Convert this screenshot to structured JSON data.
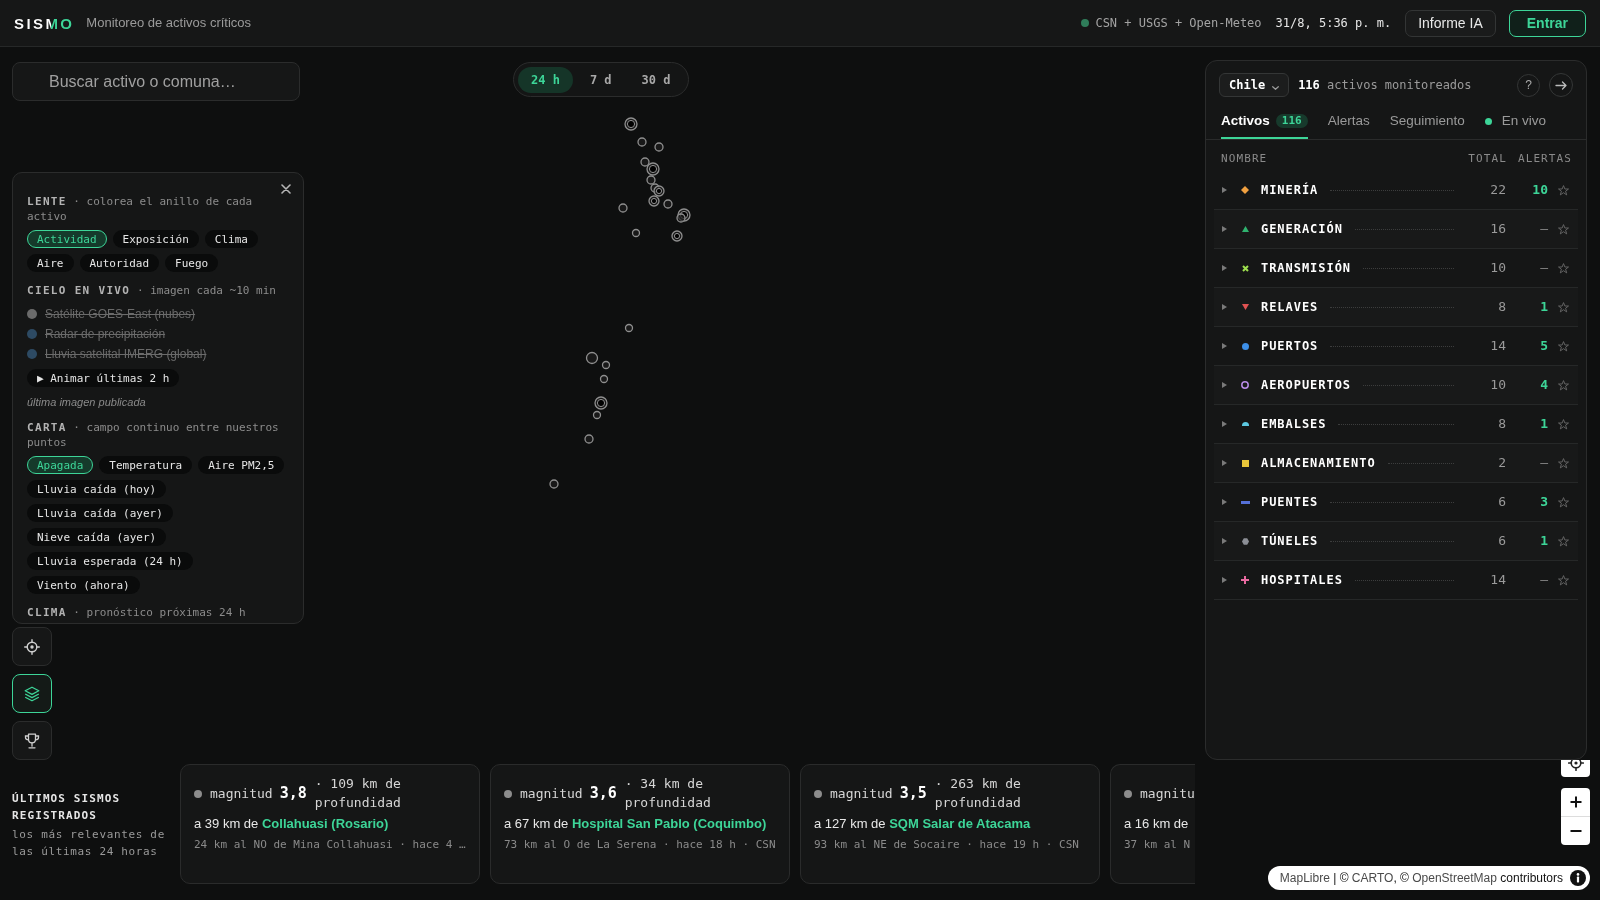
{
  "header": {
    "logo": "SISMO",
    "subtitle": "Monitoreo de activos críticos",
    "sources": "CSN + USGS + Open-Meteo",
    "datetime": "31/8, 5:36 p. m.",
    "buttons": [
      {
        "label": "Informe IA",
        "kind": "secondary"
      },
      {
        "label": "Entrar",
        "kind": "primary"
      }
    ]
  },
  "search": {
    "placeholder": "Buscar activo o comuna…"
  },
  "time_range": [
    {
      "label": "24 h",
      "selected": true
    },
    {
      "label": "7 d",
      "selected": false
    },
    {
      "label": "30 d",
      "selected": false
    }
  ],
  "layers_panel": {
    "sections": [
      {
        "kind": "chips",
        "heading": "**LENTE** · colorea el anillo de cada activo",
        "chips": [
          {
            "label": "Actividad",
            "selected": true
          },
          {
            "label": "Exposición",
            "selected": false
          },
          {
            "label": "Clima",
            "selected": false
          },
          {
            "label": "Aire",
            "selected": false
          },
          {
            "label": "Autoridad",
            "selected": false
          },
          {
            "label": "Fuego",
            "selected": false
          }
        ]
      },
      {
        "kind": "live",
        "heading": "**CIELO EN VIVO** · imagen cada ~10 min",
        "layers": [
          {
            "label": "Satélite GOES-East (nubes)",
            "on": false,
            "color": "#6b6b6b"
          },
          {
            "label": "Radar de precipitación",
            "on": false,
            "color": "#2d4a63"
          },
          {
            "label": "Lluvia satelital IMERG (global)",
            "on": false,
            "color": "#2d4a63"
          }
        ],
        "action": "▶ Animar últimas 2 h",
        "note": "última imagen publicada"
      },
      {
        "kind": "chips",
        "heading": "**CARTA** · campo continuo entre nuestros puntos",
        "chips": [
          {
            "label": "Apagada",
            "selected": true
          },
          {
            "label": "Temperatura",
            "selected": false
          },
          {
            "label": "Aire PM2,5",
            "selected": false
          },
          {
            "label": "Lluvia caída (hoy)",
            "selected": false
          },
          {
            "label": "Lluvia caída (ayer)",
            "selected": false
          },
          {
            "label": "Nieve caída (ayer)",
            "selected": false
          },
          {
            "label": "Lluvia esperada (24 h)",
            "selected": false
          },
          {
            "label": "Viento (ahora)",
            "selected": false
          }
        ]
      },
      {
        "kind": "heading",
        "heading": "**CLIMA** · pronóstico próximas 24 h"
      }
    ]
  },
  "tool_buttons": [
    {
      "selected": false
    },
    {
      "selected": true
    },
    {
      "selected": false
    }
  ],
  "recent_quakes": {
    "title": "ÚLTIMOS SISMOS REGISTRADOS",
    "subtitle": "los más relevantes de las últimas 24 horas",
    "cards": [
      {
        "label": "magnitud",
        "magnitude": "3,8",
        "depth": "· 109 km de profundidad",
        "distance": "a 39 km de",
        "asset": "Collahuasi (Rosario)",
        "detail": "24 km al NO de Mina Collahuasi · hace 4 …"
      },
      {
        "label": "magnitud",
        "magnitude": "3,6",
        "depth": "· 34 km de profundidad",
        "distance": "a 67 km de",
        "asset": "Hospital San Pablo (Coquimbo)",
        "detail": "73 km al O de La Serena · hace 18 h · CSN"
      },
      {
        "label": "magnitud",
        "magnitude": "3,5",
        "depth": "· 263 km de profundidad",
        "distance": "a 127 km de",
        "asset": "SQM Salar de Atacama",
        "detail": "93 km al NE de Socaire · hace 19 h · CSN"
      },
      {
        "label": "magnitu",
        "distance": "a 16 km de",
        "detail": "37 km al N"
      }
    ]
  },
  "assets_panel": {
    "region": "Chile",
    "summary": "**116** activos monitoreados",
    "help_label": "?",
    "tabs": [
      {
        "label": "Activos",
        "badge": "116",
        "selected": true,
        "kind": "tab"
      },
      {
        "label": "Alertas",
        "selected": false,
        "kind": "tab"
      },
      {
        "label": "Seguimiento",
        "selected": false,
        "kind": "tab"
      },
      {
        "label": "En vivo",
        "selected": false,
        "kind": "live"
      }
    ],
    "columns": [
      "NOMBRE",
      "TOTAL",
      "ALERTAS"
    ],
    "categories": [
      {
        "name": "MINERÍA",
        "color": "#f0a040",
        "total": "22",
        "alerts": "10",
        "alerting": true,
        "expanded": false,
        "starred": false
      },
      {
        "name": "GENERACIÓN",
        "color": "#2fb36f",
        "total": "16",
        "alerts": "–",
        "alerting": false,
        "expanded": false,
        "starred": false
      },
      {
        "name": "TRANSMISIÓN",
        "color": "#9ee04f",
        "total": "10",
        "alerts": "–",
        "alerting": false,
        "expanded": false,
        "starred": false
      },
      {
        "name": "RELAVES",
        "color": "#e05252",
        "total": "8",
        "alerts": "1",
        "alerting": true,
        "expanded": false,
        "starred": false
      },
      {
        "name": "PUERTOS",
        "color": "#3d8fe8",
        "total": "14",
        "alerts": "5",
        "alerting": true,
        "expanded": false,
        "starred": false
      },
      {
        "name": "AEROPUERTOS",
        "color": "#b88be6",
        "total": "10",
        "alerts": "4",
        "alerting": true,
        "expanded": false,
        "starred": false
      },
      {
        "name": "EMBALSES",
        "color": "#5cc8e0",
        "total": "8",
        "alerts": "1",
        "alerting": true,
        "expanded": false,
        "starred": false
      },
      {
        "name": "ALMACENAMIENTO",
        "color": "#e8c53a",
        "total": "2",
        "alerts": "–",
        "alerting": false,
        "expanded": false,
        "starred": false
      },
      {
        "name": "PUENTES",
        "color": "#5570d8",
        "total": "6",
        "alerts": "3",
        "alerting": true,
        "expanded": false,
        "starred": false
      },
      {
        "name": "TÚNELES",
        "color": "#8c8f96",
        "total": "6",
        "alerts": "1",
        "alerting": true,
        "expanded": false,
        "starred": false
      },
      {
        "name": "HOSPITALES",
        "color": "#e86aa0",
        "total": "14",
        "alerts": "–",
        "alerting": false,
        "expanded": false,
        "starred": false
      }
    ]
  },
  "map_attribution": [
    {
      "kind": "link",
      "text": "MapLibre"
    },
    {
      "kind": "text",
      "text": " | © "
    },
    {
      "kind": "link",
      "text": "CARTO"
    },
    {
      "kind": "text",
      "text": ", © "
    },
    {
      "kind": "link",
      "text": "OpenStreetMap"
    },
    {
      "kind": "text",
      "text": " contributors"
    }
  ]
}
